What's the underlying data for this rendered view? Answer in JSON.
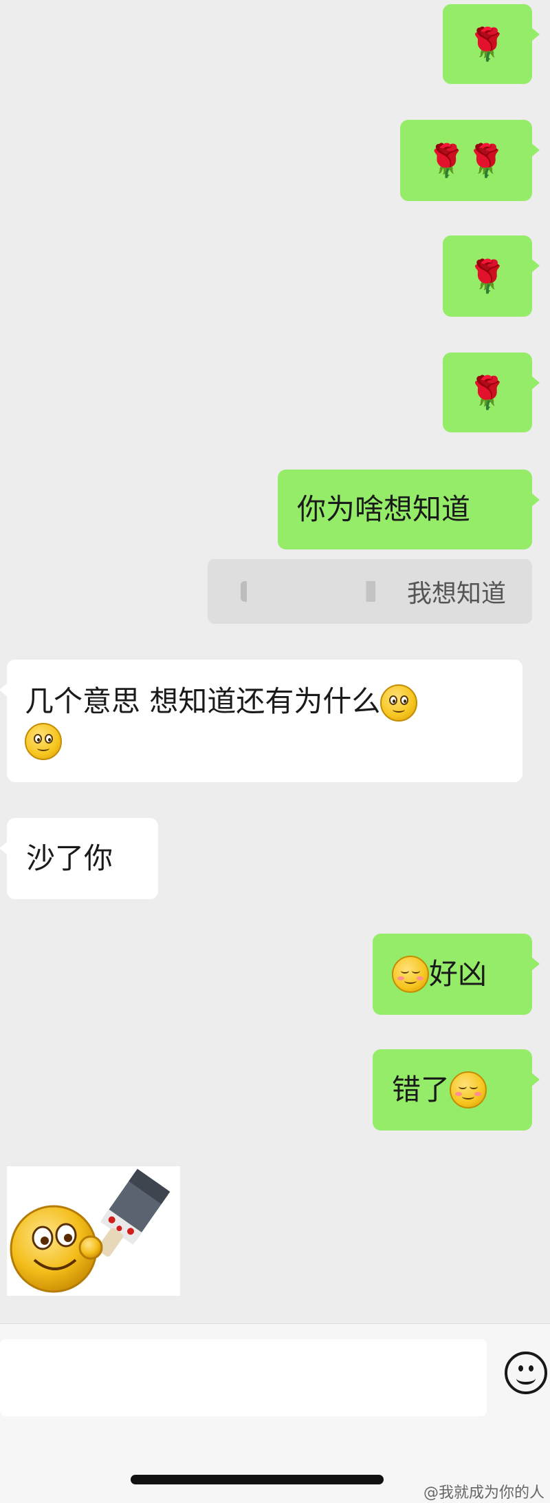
{
  "messages": [
    {
      "side": "out",
      "content": "🌹"
    },
    {
      "side": "out",
      "content": "🌹🌹"
    },
    {
      "side": "out",
      "content": "🌹"
    },
    {
      "side": "out",
      "content": "🌹"
    },
    {
      "side": "out",
      "content": "你为啥想知道"
    },
    {
      "side": "quote",
      "content": "我想知道"
    },
    {
      "side": "in",
      "line1": "几个意思 想知道还有为什么",
      "emoji": "smile"
    },
    {
      "side": "in",
      "content": "沙了你"
    },
    {
      "side": "out",
      "content": "好凶",
      "emoji": "shy"
    },
    {
      "side": "out",
      "content": "错了",
      "emoji": "shy"
    },
    {
      "side": "in",
      "content": "sticker",
      "sticker": "smiley-with-cleaver"
    }
  ],
  "input": {
    "placeholder": "",
    "emoji_button": "smiley-face-icon"
  },
  "watermark": "@我就成为你的人"
}
